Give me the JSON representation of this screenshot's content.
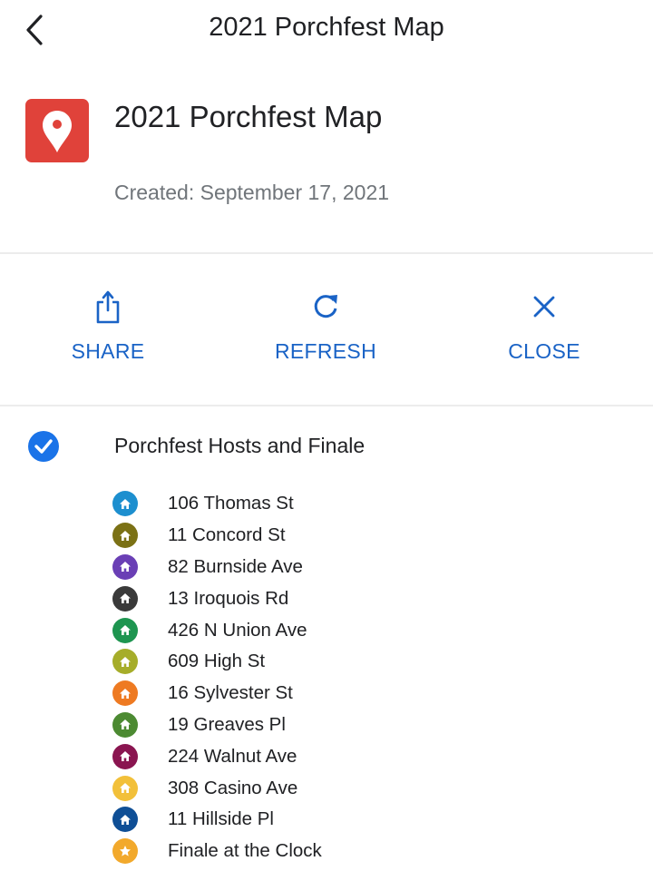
{
  "header": {
    "title": "2021 Porchfest Map",
    "back_icon": "chevron-left-icon"
  },
  "map_info": {
    "icon": "map-pin-icon",
    "icon_color": "#e0423a",
    "name": "2021 Porchfest Map",
    "created": "Created: September 17, 2021"
  },
  "actions": [
    {
      "label": "SHARE",
      "icon": "share-icon"
    },
    {
      "label": "REFRESH",
      "icon": "refresh-icon"
    },
    {
      "label": "CLOSE",
      "icon": "close-icon"
    }
  ],
  "accent_color": "#1a63c6",
  "layer": {
    "title": "Porchfest Hosts and Finale",
    "checked": true,
    "items": [
      {
        "label": "106 Thomas St",
        "color": "#1d8fcf",
        "icon": "house-icon"
      },
      {
        "label": "11 Concord St",
        "color": "#7b7115",
        "icon": "house-icon"
      },
      {
        "label": "82 Burnside Ave",
        "color": "#6a3fb5",
        "icon": "house-icon"
      },
      {
        "label": "13 Iroquois Rd",
        "color": "#3a3a3a",
        "icon": "house-icon"
      },
      {
        "label": "426 N Union Ave",
        "color": "#1e9550",
        "icon": "house-icon"
      },
      {
        "label": "609 High St",
        "color": "#a6ad2a",
        "icon": "house-icon"
      },
      {
        "label": "16 Sylvester St",
        "color": "#ee7a22",
        "icon": "house-icon"
      },
      {
        "label": "19 Greaves Pl",
        "color": "#4c8a32",
        "icon": "house-icon"
      },
      {
        "label": "224 Walnut Ave",
        "color": "#8a1550",
        "icon": "house-icon"
      },
      {
        "label": "308 Casino Ave",
        "color": "#f2c03a",
        "icon": "house-icon"
      },
      {
        "label": "11 Hillside Pl",
        "color": "#0f4f96",
        "icon": "house-icon"
      },
      {
        "label": "Finale at the Clock",
        "color": "#f2a92c",
        "icon": "star-icon"
      }
    ]
  }
}
